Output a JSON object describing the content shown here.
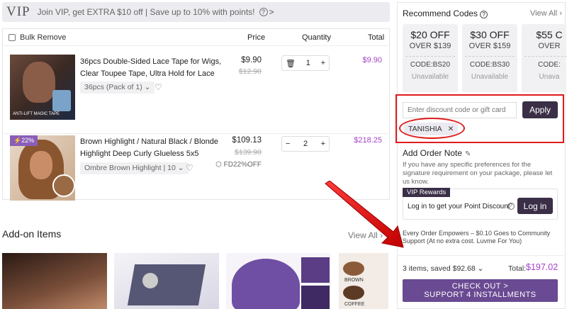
{
  "vip_banner": {
    "logo": "VIP",
    "text": "Join VIP, get EXTRA $10 off | Save up to 10% with points!",
    "help_icon": "question-circle-icon",
    "arrow": ">"
  },
  "cart": {
    "bulk_remove": "Bulk Remove",
    "headers": {
      "price": "Price",
      "quantity": "Quantity",
      "total": "Total"
    },
    "items": [
      {
        "title": "36pcs Double-Sided Lace Tape for Wigs, Clear Toupee Tape, Ultra Hold for Lace Wigs",
        "variant": "36pcs (Pack of 1)",
        "price": "$9.90",
        "original_price": "$12.90",
        "quantity": "1",
        "total": "$9.90",
        "thumb_caption": "ANTI-LIFT MAGIC TAPE"
      },
      {
        "badge": "22%",
        "title": "Brown Highlight / Natural Black / Blonde Highlight Deep Curly Glueless 5x5 Closure...",
        "variant": "Ombre Brown Highlight | 10",
        "price": "$109.13",
        "original_price": "$139.90",
        "coupon": "FD22%OFF",
        "quantity": "2",
        "total": "$218.25"
      }
    ]
  },
  "addon": {
    "title": "Add-on Items",
    "view_all": "View All",
    "swatch_labels": [
      "BROWN",
      "COFFEE"
    ]
  },
  "recommend": {
    "title": "Recommend Codes",
    "view_all": "View All",
    "coupons": [
      {
        "off": "$20 OFF",
        "over": "OVER $139",
        "code": "CODE:BS20",
        "status": "Unavailable"
      },
      {
        "off": "$30 OFF",
        "over": "OVER $159",
        "code": "CODE:BS30",
        "status": "Unavailable"
      },
      {
        "off": "$55 C",
        "over": "OVER",
        "code": "CODE:",
        "status": "Unava"
      }
    ]
  },
  "discount": {
    "placeholder": "Enter discount code or gift card",
    "apply": "Apply",
    "applied_code": "TANISHIA"
  },
  "order_note": {
    "title": "Add Order Note",
    "text": "If you have any specific preferences for the signature requirement on your package, please let us know."
  },
  "vip_rewards": {
    "tag": "VIP Rewards",
    "text": "Log in to get your Point Discount",
    "button": "Log in"
  },
  "empower": "Every Order Empowers – $0.10 Goes to Community Support (At no extra cost. Luvme For You)",
  "summary": {
    "items_saved": "3 items, saved $92.68",
    "total_label": "Total:",
    "total_value": "$197.02"
  },
  "checkout": {
    "line1": "CHECK OUT >",
    "line2": "SUPPORT 4 INSTALLMENTS"
  },
  "colors": {
    "accent_purple": "#a443c6",
    "dark_button": "#3a2f47",
    "checkout": "#6a4a92",
    "annotation_red": "#e01b1b"
  }
}
